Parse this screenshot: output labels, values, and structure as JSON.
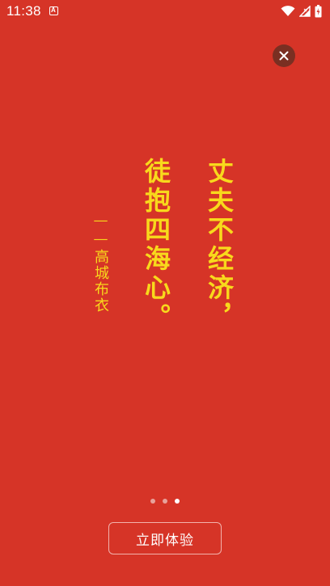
{
  "status_bar": {
    "time": "11:38",
    "notification_icon": "a-notification-icon",
    "icons": [
      "wifi-icon",
      "cell-signal-icon",
      "battery-icon"
    ]
  },
  "close_button": {
    "icon": "close-icon"
  },
  "poem": {
    "line1": "丈夫不经济，",
    "line2": "徒抱四海心。",
    "author": "——高城布衣"
  },
  "pager": {
    "total": 3,
    "active_index": 2
  },
  "experience_button": {
    "label": "立即体验"
  },
  "colors": {
    "background": "#D63427",
    "poem_text": "#F8D91C",
    "close_bg": "#7A2F22",
    "button_border": "#F2B2AC"
  }
}
